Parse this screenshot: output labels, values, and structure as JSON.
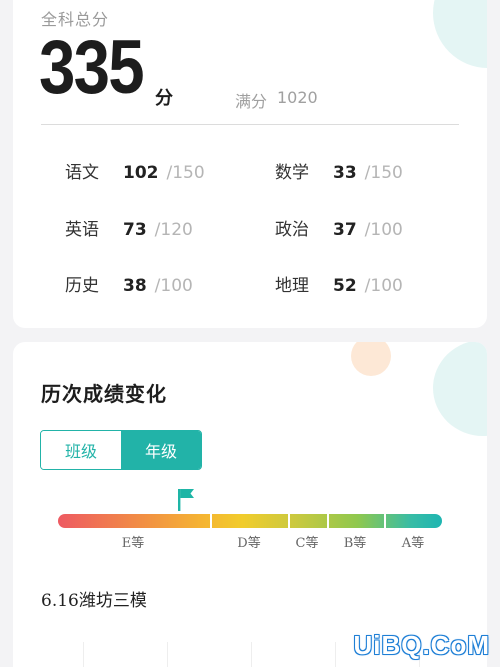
{
  "summary": {
    "total_label": "全科总分",
    "total_score": "335",
    "total_unit": "分",
    "full_label": "满分",
    "full_value": "1020"
  },
  "subjects": [
    {
      "name": "语文",
      "score": "102",
      "max": "/150"
    },
    {
      "name": "数学",
      "score": "33",
      "max": "/150"
    },
    {
      "name": "英语",
      "score": "73",
      "max": "/120"
    },
    {
      "name": "政治",
      "score": "37",
      "max": "/100"
    },
    {
      "name": "历史",
      "score": "38",
      "max": "/100"
    },
    {
      "name": "地理",
      "score": "52",
      "max": "/100"
    }
  ],
  "history": {
    "title": "历次成绩变化",
    "tabs": [
      {
        "label": "班级",
        "active": false
      },
      {
        "label": "年级",
        "active": true
      }
    ],
    "grades": [
      "E等",
      "D等",
      "C等",
      "B等",
      "A等"
    ],
    "exam_name": "6.16潍坊三模"
  },
  "colors": {
    "accent": "#22b3a8",
    "flag": "#1eb5a6"
  },
  "watermark": "UiBQ.CoM"
}
